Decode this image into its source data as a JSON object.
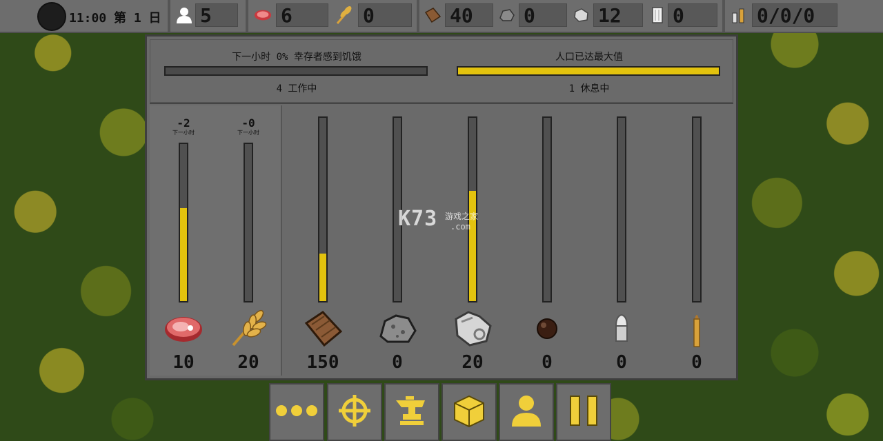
{
  "hud": {
    "time": "11:00 第 1 日",
    "population": "5",
    "meat": "6",
    "wheat": "0",
    "wood": "40",
    "stone": "0",
    "metal": "12",
    "paper": "0",
    "ammo": "0/0/0"
  },
  "status": {
    "hunger_text": "下一小时 0% 幸存者感到饥饿",
    "hunger_level": 0,
    "population_text": "人口已达最大值",
    "population_level": 1.0,
    "working_text": "4 工作中",
    "resting_text": "1 休息中"
  },
  "food_columns": [
    {
      "name": "meat",
      "icon": "meat-icon",
      "rate": "-2",
      "rate_unit": "下一小时",
      "level": 0.59,
      "count": "10"
    },
    {
      "name": "wheat",
      "icon": "wheat-icon",
      "rate": "-0",
      "rate_unit": "下一小时",
      "level": 0.0,
      "count": "20"
    }
  ],
  "storage_columns": [
    {
      "name": "wood",
      "icon": "wood-icon",
      "level": 0.26,
      "count": "150"
    },
    {
      "name": "stone",
      "icon": "stone-icon",
      "level": 0.0,
      "count": "0"
    },
    {
      "name": "metal",
      "icon": "metal-scrap-icon",
      "level": 0.6,
      "count": "20"
    },
    {
      "name": "cannonball",
      "icon": "cannonball-icon",
      "level": 0.0,
      "count": "0"
    },
    {
      "name": "bullet",
      "icon": "bullet-icon",
      "level": 0.0,
      "count": "0"
    },
    {
      "name": "rifle-round",
      "icon": "rifle-round-icon",
      "level": 0.0,
      "count": "0"
    }
  ],
  "toolbar": [
    {
      "name": "more-button",
      "icon": "more-dots-icon"
    },
    {
      "name": "target-button",
      "icon": "crosshair-icon"
    },
    {
      "name": "craft-button",
      "icon": "anvil-icon"
    },
    {
      "name": "storage-button",
      "icon": "crate-icon"
    },
    {
      "name": "survivors-button",
      "icon": "person-icon"
    },
    {
      "name": "pause-button",
      "icon": "pause-icon"
    }
  ],
  "watermark": {
    "logo": "K73",
    "site": "游戏之家",
    "domain": ".com"
  },
  "colors": {
    "accent_yellow": "#e3c30e",
    "panel": "#6a6a6a",
    "bar_bg": "#505050"
  }
}
